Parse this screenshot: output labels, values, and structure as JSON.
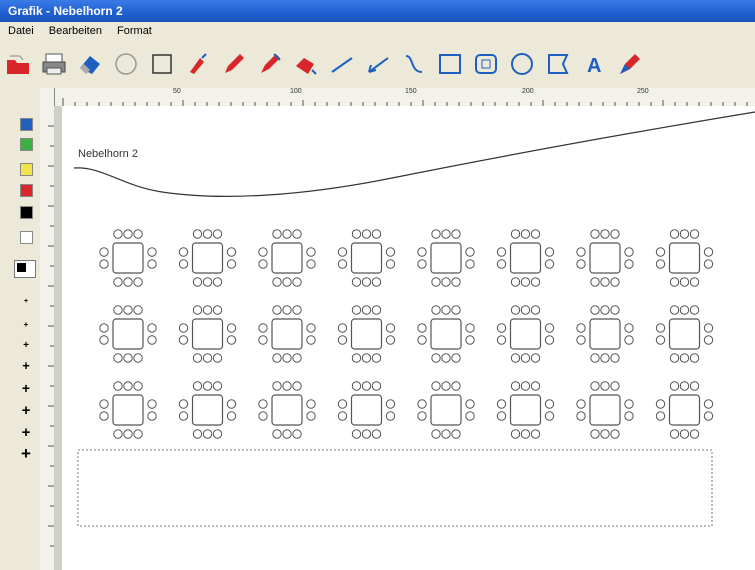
{
  "window": {
    "title": "Grafik - Nebelhorn 2"
  },
  "menu": [
    "Datei",
    "Bearbeiten",
    "Format"
  ],
  "toolbar": {
    "tools": [
      "open-folder-icon",
      "print-icon",
      "eraser-icon",
      "lasso-icon",
      "select-rectangle-icon",
      "fill-bucket-icon",
      "pencil-icon",
      "brush-icon",
      "highlighter-icon",
      "line-icon",
      "arrow-line-icon",
      "curve-icon",
      "rectangle-icon",
      "rounded-rectangle-icon",
      "ellipse-icon",
      "polygon-icon",
      "text-icon",
      "pen-icon"
    ]
  },
  "ruler": {
    "h_labels": [
      "50",
      "100",
      "150",
      "200",
      "250"
    ]
  },
  "palette": {
    "colors": [
      "#1f5fc0",
      "#3cb043",
      "#f2e24b",
      "#d9262b",
      "#000000",
      "#ffffff"
    ],
    "current_color": "#000000"
  },
  "canvas": {
    "label": "Nebelhorn 2"
  }
}
